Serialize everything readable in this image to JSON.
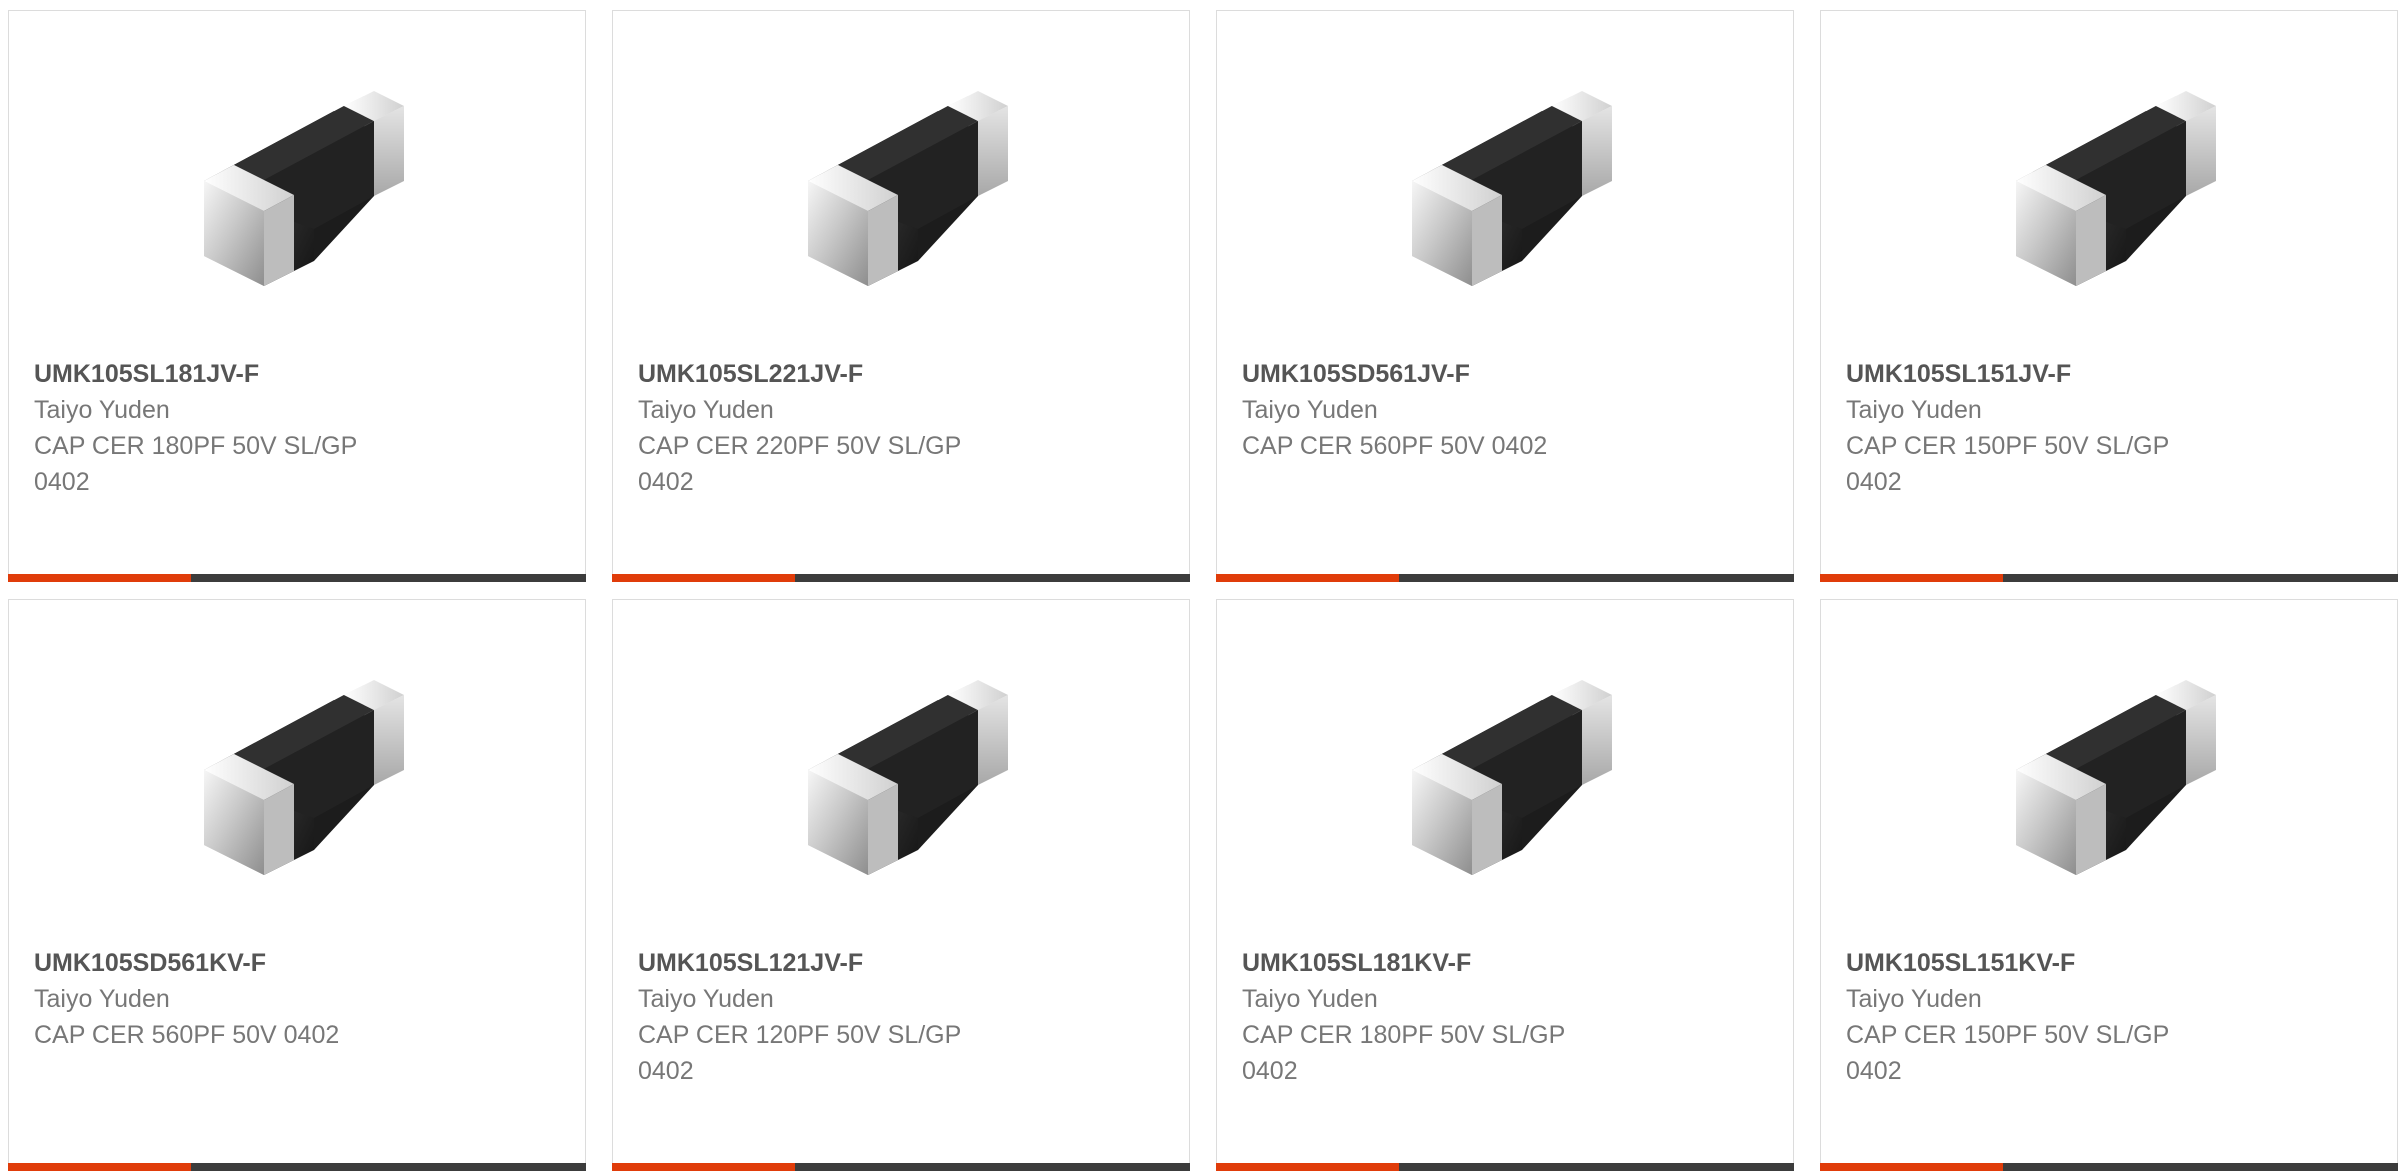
{
  "accent_color": "#e03c0a",
  "product_image_icon": "ceramic-capacitor-chip",
  "cards": [
    {
      "part_number": "UMK105SL181JV-F",
      "manufacturer": "Taiyo Yuden",
      "description": "CAP CER 180PF 50V SL/GP 0402"
    },
    {
      "part_number": "UMK105SL221JV-F",
      "manufacturer": "Taiyo Yuden",
      "description": "CAP CER 220PF 50V SL/GP 0402"
    },
    {
      "part_number": "UMK105SD561JV-F",
      "manufacturer": "Taiyo Yuden",
      "description": "CAP CER 560PF 50V 0402"
    },
    {
      "part_number": "UMK105SL151JV-F",
      "manufacturer": "Taiyo Yuden",
      "description": "CAP CER 150PF 50V SL/GP 0402"
    },
    {
      "part_number": "UMK105SD561KV-F",
      "manufacturer": "Taiyo Yuden",
      "description": "CAP CER 560PF 50V 0402"
    },
    {
      "part_number": "UMK105SL121JV-F",
      "manufacturer": "Taiyo Yuden",
      "description": "CAP CER 120PF 50V SL/GP 0402"
    },
    {
      "part_number": "UMK105SL181KV-F",
      "manufacturer": "Taiyo Yuden",
      "description": "CAP CER 180PF 50V SL/GP 0402"
    },
    {
      "part_number": "UMK105SL151KV-F",
      "manufacturer": "Taiyo Yuden",
      "description": "CAP CER 150PF 50V SL/GP 0402"
    }
  ]
}
